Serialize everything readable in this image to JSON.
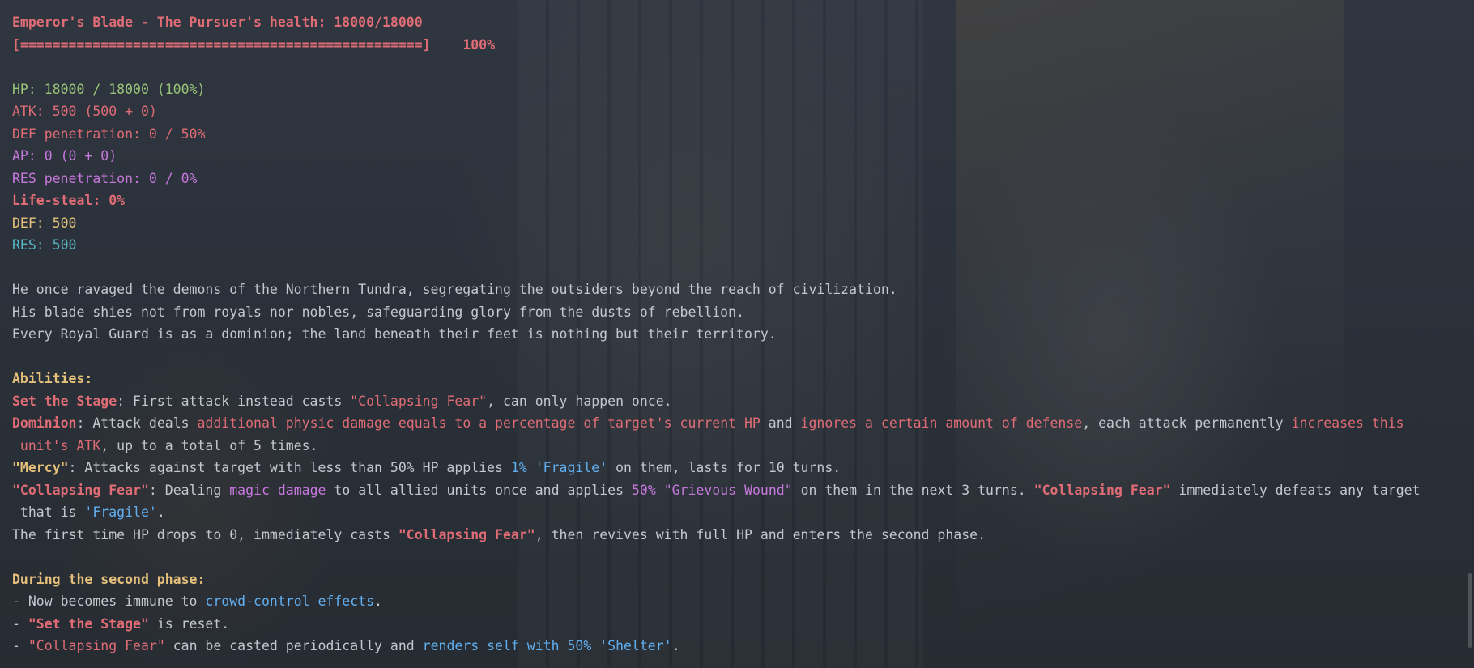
{
  "header": {
    "health_line": "Emperor's Blade - The Pursuer's health: 18000/18000",
    "bar": "[==================================================]",
    "bar_percent": "100%",
    "health_fraction": 1.0
  },
  "stats": {
    "hp": "HP: 18000 / 18000 (100%)",
    "atk": "ATK: 500 (500 + 0)",
    "def_pen": "DEF penetration: 0 / 50%",
    "ap": "AP: 0 (0 + 0)",
    "res_pen": "RES penetration: 0 / 0%",
    "life_steal": "Life-steal: 0%",
    "def": "DEF: 500",
    "res": "RES: 500"
  },
  "lore": [
    "He once ravaged the demons of the Northern Tundra, segregating the outsiders beyond the reach of civilization.",
    "His blade shies not from royals nor nobles, safeguarding glory from the dusts of rebellion.",
    "Every Royal Guard is as a dominion; the land beneath their feet is nothing but their territory."
  ],
  "abilities": {
    "heading": "Abilities:",
    "set_stage": {
      "name": "Set the Stage",
      "t1": ": First attack instead casts ",
      "q1": "\"Collapsing Fear\"",
      "t2": ", can only happen once."
    },
    "dominion": {
      "name": "Dominion",
      "t1": ": Attack deals ",
      "h1": "additional physic damage equals to a percentage of target's current HP",
      "t2": " and ",
      "h2": "ignores a certain amount of defense",
      "t3": ", each attack permanently ",
      "h3": "increases this",
      "h4": " unit's ATK",
      "t4": ", up to a total of 5 times."
    },
    "mercy": {
      "name": "\"Mercy\"",
      "t1": ": Attacks against target with less than 50% HP applies ",
      "h1": "1% 'Fragile'",
      "t2": " on them, lasts for 10 turns."
    },
    "collapsing": {
      "name": "\"Collapsing Fear\"",
      "t1": ": Dealing ",
      "h1": "magic damage",
      "t2": " to all allied units once and applies ",
      "h2": "50% \"Grievous Wound\"",
      "t3": " on them in the next 3 turns. ",
      "h3": "\"Collapsing Fear\"",
      "t4": " immediately defeats any target",
      "t5": " that is ",
      "h4": "'Fragile'",
      "t6": "."
    },
    "first_time": {
      "t1": "The first time HP drops to 0, immediately casts ",
      "h1": "\"Collapsing Fear\"",
      "t2": ", then revives with full HP and enters the second phase."
    }
  },
  "second_phase": {
    "heading": "During the second phase:",
    "l1": {
      "t1": "- Now becomes immune to ",
      "h1": "crowd-control effects",
      "t2": "."
    },
    "l2": {
      "t1": "- ",
      "h1": "\"Set the Stage\"",
      "t2": " is reset."
    },
    "l3": {
      "t1": "- ",
      "h1": "\"Collapsing Fear\"",
      "t2": " can be casted periodically and ",
      "h2": "renders self with 50% 'Shelter'",
      "t3": "."
    }
  }
}
